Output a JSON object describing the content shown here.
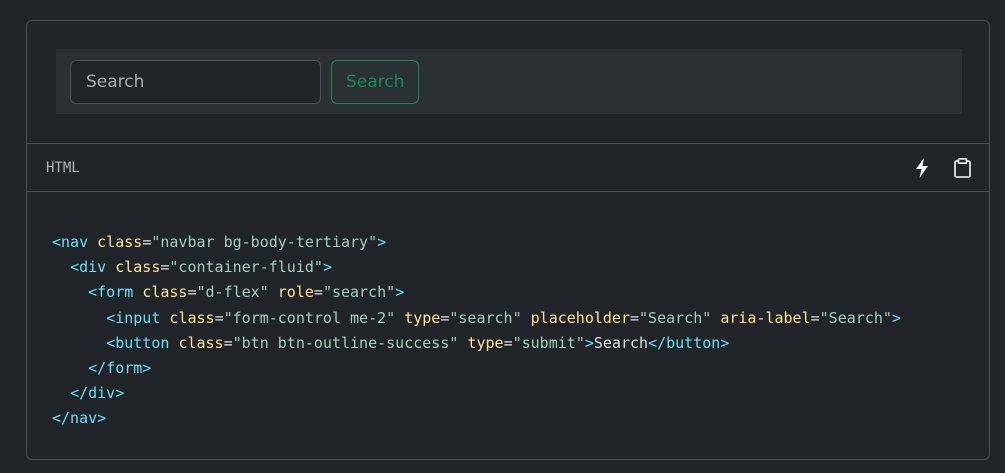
{
  "preview": {
    "search_placeholder": "Search",
    "search_aria_label": "Search",
    "button_label": "Search"
  },
  "code_header": {
    "language": "HTML",
    "run_icon": "lightning-icon",
    "copy_icon": "clipboard-icon"
  },
  "colors": {
    "success": "#198754",
    "tag": "#6edff6",
    "attribute": "#ffe69c",
    "string": "#a3cfbb"
  },
  "code_lines": [
    [
      {
        "t": "tag",
        "s": "<nav"
      },
      {
        "t": "p",
        "s": " "
      },
      {
        "t": "attr",
        "s": "class"
      },
      {
        "t": "p",
        "s": "="
      },
      {
        "t": "str",
        "s": "\"navbar bg-body-tertiary\""
      },
      {
        "t": "tag",
        "s": ">"
      }
    ],
    [
      {
        "t": "p",
        "s": "  "
      },
      {
        "t": "tag",
        "s": "<div"
      },
      {
        "t": "p",
        "s": " "
      },
      {
        "t": "attr",
        "s": "class"
      },
      {
        "t": "p",
        "s": "="
      },
      {
        "t": "str",
        "s": "\"container-fluid\""
      },
      {
        "t": "tag",
        "s": ">"
      }
    ],
    [
      {
        "t": "p",
        "s": "    "
      },
      {
        "t": "tag",
        "s": "<form"
      },
      {
        "t": "p",
        "s": " "
      },
      {
        "t": "attr",
        "s": "class"
      },
      {
        "t": "p",
        "s": "="
      },
      {
        "t": "str",
        "s": "\"d-flex\""
      },
      {
        "t": "p",
        "s": " "
      },
      {
        "t": "attr",
        "s": "role"
      },
      {
        "t": "p",
        "s": "="
      },
      {
        "t": "str",
        "s": "\"search\""
      },
      {
        "t": "tag",
        "s": ">"
      }
    ],
    [
      {
        "t": "p",
        "s": "      "
      },
      {
        "t": "tag",
        "s": "<input"
      },
      {
        "t": "p",
        "s": " "
      },
      {
        "t": "attr",
        "s": "class"
      },
      {
        "t": "p",
        "s": "="
      },
      {
        "t": "str",
        "s": "\"form-control me-2\""
      },
      {
        "t": "p",
        "s": " "
      },
      {
        "t": "attr",
        "s": "type"
      },
      {
        "t": "p",
        "s": "="
      },
      {
        "t": "str",
        "s": "\"search\""
      },
      {
        "t": "p",
        "s": " "
      },
      {
        "t": "attr",
        "s": "placeholder"
      },
      {
        "t": "p",
        "s": "="
      },
      {
        "t": "str",
        "s": "\"Search\""
      },
      {
        "t": "p",
        "s": " "
      },
      {
        "t": "attr",
        "s": "aria-label"
      },
      {
        "t": "p",
        "s": "="
      },
      {
        "t": "str",
        "s": "\"Search\""
      },
      {
        "t": "tag",
        "s": ">"
      }
    ],
    [
      {
        "t": "p",
        "s": "      "
      },
      {
        "t": "tag",
        "s": "<button"
      },
      {
        "t": "p",
        "s": " "
      },
      {
        "t": "attr",
        "s": "class"
      },
      {
        "t": "p",
        "s": "="
      },
      {
        "t": "str",
        "s": "\"btn btn-outline-success\""
      },
      {
        "t": "p",
        "s": " "
      },
      {
        "t": "attr",
        "s": "type"
      },
      {
        "t": "p",
        "s": "="
      },
      {
        "t": "str",
        "s": "\"submit\""
      },
      {
        "t": "tag",
        "s": ">"
      },
      {
        "t": "p",
        "s": "Search"
      },
      {
        "t": "tag",
        "s": "</button>"
      }
    ],
    [
      {
        "t": "p",
        "s": "    "
      },
      {
        "t": "tag",
        "s": "</form>"
      }
    ],
    [
      {
        "t": "p",
        "s": "  "
      },
      {
        "t": "tag",
        "s": "</div>"
      }
    ],
    [
      {
        "t": "tag",
        "s": "</nav>"
      }
    ]
  ]
}
